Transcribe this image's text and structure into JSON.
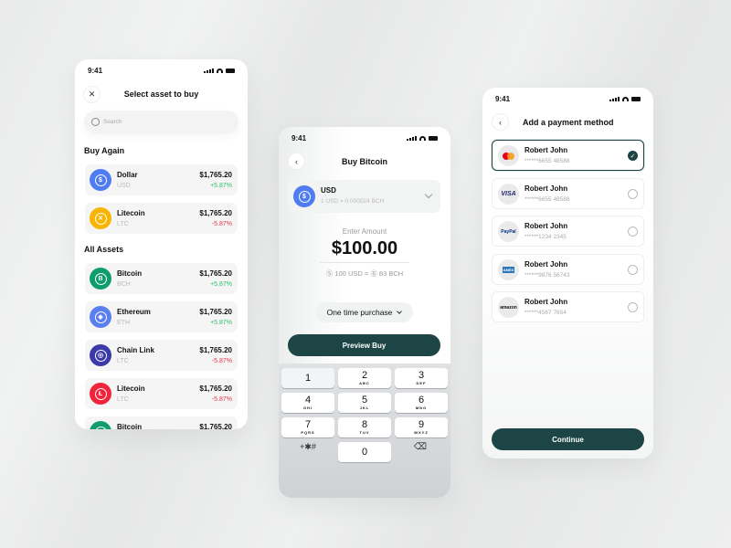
{
  "status_time": "9:41",
  "colors": {
    "primary": "#1d4545",
    "positive": "#2fbf6a",
    "negative": "#e0344f"
  },
  "select_asset": {
    "title": "Select asset to buy",
    "close_icon": "close-icon",
    "search_placeholder": "Search",
    "buy_again_label": "Buy Again",
    "buy_again": [
      {
        "name": "Dollar",
        "symbol": "USD",
        "price": "$1,765.20",
        "change": "+5.87%",
        "trend": "up",
        "color": "#4f7cf0",
        "icon": "$"
      },
      {
        "name": "Litecoin",
        "symbol": "LTC",
        "price": "$1,765.20",
        "change": "-5.87%",
        "trend": "down",
        "color": "#f7b500",
        "icon": "✕"
      }
    ],
    "all_assets_label": "All Assets",
    "all_assets": [
      {
        "name": "Bitcoin",
        "symbol": "BCH",
        "price": "$1,765.20",
        "change": "+5.87%",
        "trend": "up",
        "color": "#0f9d6b",
        "icon": "B"
      },
      {
        "name": "Ethereum",
        "symbol": "ETH",
        "price": "$1,765.20",
        "change": "+5.87%",
        "trend": "up",
        "color": "#5a7ff0",
        "icon": "◈"
      },
      {
        "name": "Chain Link",
        "symbol": "LTC",
        "price": "$1,765.20",
        "change": "-5.87%",
        "trend": "down",
        "color": "#3b3aa8",
        "icon": "◎"
      },
      {
        "name": "Litecoin",
        "symbol": "LTC",
        "price": "$1,765.20",
        "change": "-5.87%",
        "trend": "down",
        "color": "#f2243b",
        "icon": "Ł"
      },
      {
        "name": "Bitcoin",
        "symbol": "BCH",
        "price": "$1,765.20",
        "change": "+5.87%",
        "trend": "up",
        "color": "#0f9d6b",
        "icon": "B"
      }
    ]
  },
  "buy": {
    "title": "Buy Bitcoin",
    "currency": "USD",
    "rate": "1 USD = 0.000024 BCH",
    "enter_label": "Enter Amount",
    "amount": "$100.00",
    "conversion": "Ⓢ 100 USD = Ⓑ 83 BCH",
    "purchase_type": "One time purchase",
    "preview_label": "Preview Buy",
    "keys": [
      {
        "d": "1",
        "l": ""
      },
      {
        "d": "2",
        "l": "ABC"
      },
      {
        "d": "3",
        "l": "DEF"
      },
      {
        "d": "4",
        "l": "GHI"
      },
      {
        "d": "5",
        "l": "JKL"
      },
      {
        "d": "6",
        "l": "MNO"
      },
      {
        "d": "7",
        "l": "PQRS"
      },
      {
        "d": "8",
        "l": "TUV"
      },
      {
        "d": "9",
        "l": "WXYZ"
      }
    ],
    "symbols_key": "+✱#",
    "zero_key": "0"
  },
  "payment": {
    "title": "Add a payment method",
    "methods": [
      {
        "brand": "Mastercard",
        "name": "Robert John",
        "number": "******6655 48588",
        "selected": true
      },
      {
        "brand": "VISA",
        "name": "Robert John",
        "number": "******6655 48588",
        "selected": false
      },
      {
        "brand": "PayPal",
        "name": "Robert John",
        "number": "******1234 2345",
        "selected": false
      },
      {
        "brand": "AMEX",
        "name": "Robert John",
        "number": "******9876 56743",
        "selected": false
      },
      {
        "brand": "amazon",
        "name": "Robert John",
        "number": "******4567 7654",
        "selected": false
      }
    ],
    "continue_label": "Continue"
  }
}
